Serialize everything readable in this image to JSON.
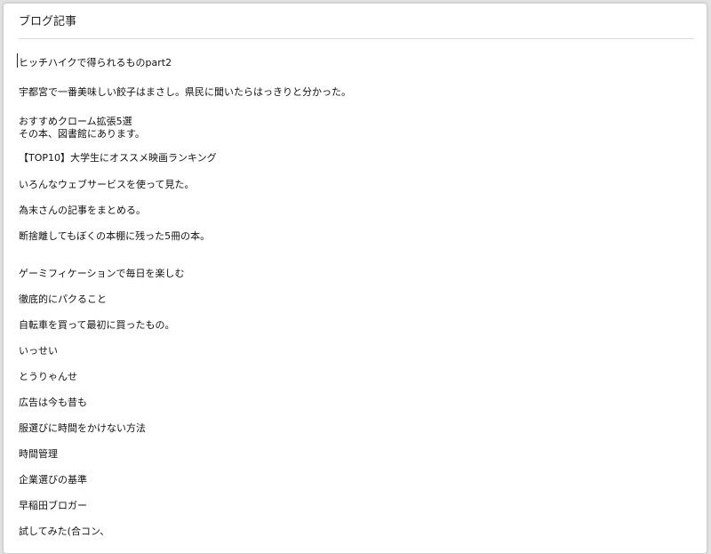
{
  "panel": {
    "title": "ブログ記事"
  },
  "editor": {
    "lines": [
      "ヒッチハイクで得られるものpart2",
      "宇都宮で一番美味しい餃子はまさし。県民に聞いたらはっきりと分かった。",
      "おすすめクローム拡張5選",
      "その本、図書館にあります。",
      "【TOP10】大学生にオススメ映画ランキング",
      "いろんなウェブサービスを使って見た。",
      "為末さんの記事をまとめる。",
      "断捨離してもぼくの本棚に残った5冊の本。",
      "ゲーミフィケーションで毎日を楽しむ",
      "徹底的にパクること",
      "自転車を買って最初に買ったもの。",
      "いっせい",
      "とうりゃんせ",
      "広告は今も昔も",
      "服選びに時間をかけない方法",
      "時間管理",
      "企業選びの基準",
      "早稲田ブロガー",
      "試してみた(合コン、"
    ]
  }
}
